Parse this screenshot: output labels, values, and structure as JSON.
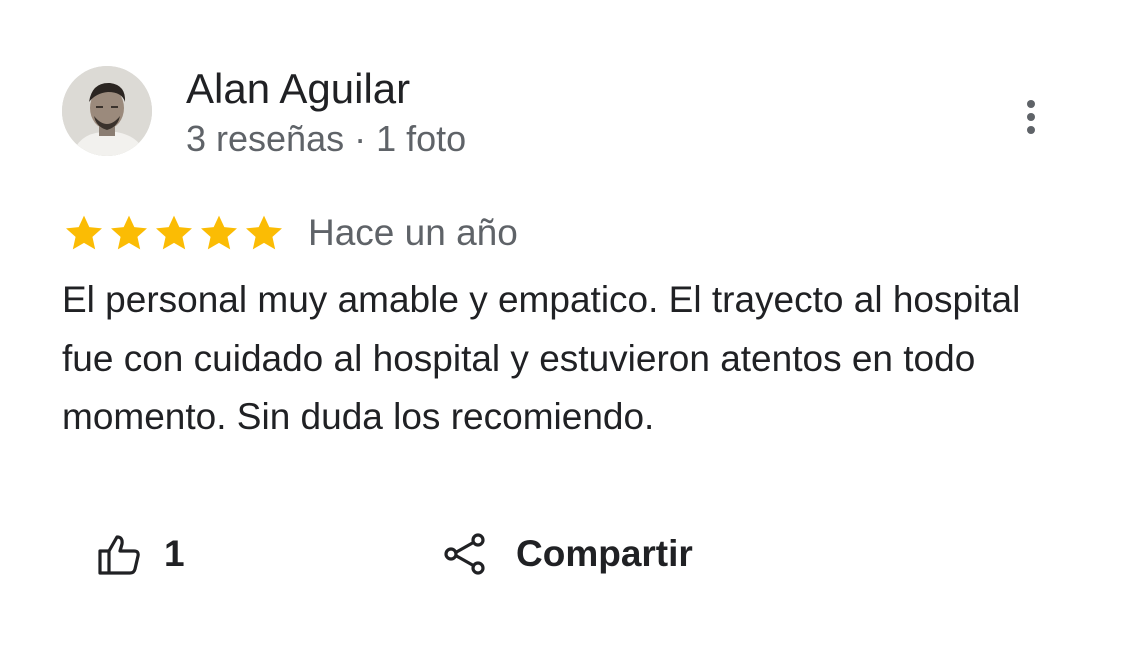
{
  "reviewer": {
    "name": "Alan Aguilar",
    "meta": "3 reseñas · 1 foto"
  },
  "review": {
    "rating": 5,
    "max_rating": 5,
    "date": "Hace un año",
    "text": "El personal muy amable y empatico. El trayecto al hospital fue con cuidado al hospital y estuvieron atentos en todo momento. Sin duda los recomiendo."
  },
  "actions": {
    "like_count": "1",
    "share_label": "Compartir"
  },
  "icons": {
    "more": "more-vert-icon",
    "star": "star-icon",
    "like": "thumb-up-icon",
    "share": "share-icon"
  },
  "colors": {
    "star": "#fbbc04",
    "text_primary": "#202124",
    "text_secondary": "#5f6368"
  }
}
